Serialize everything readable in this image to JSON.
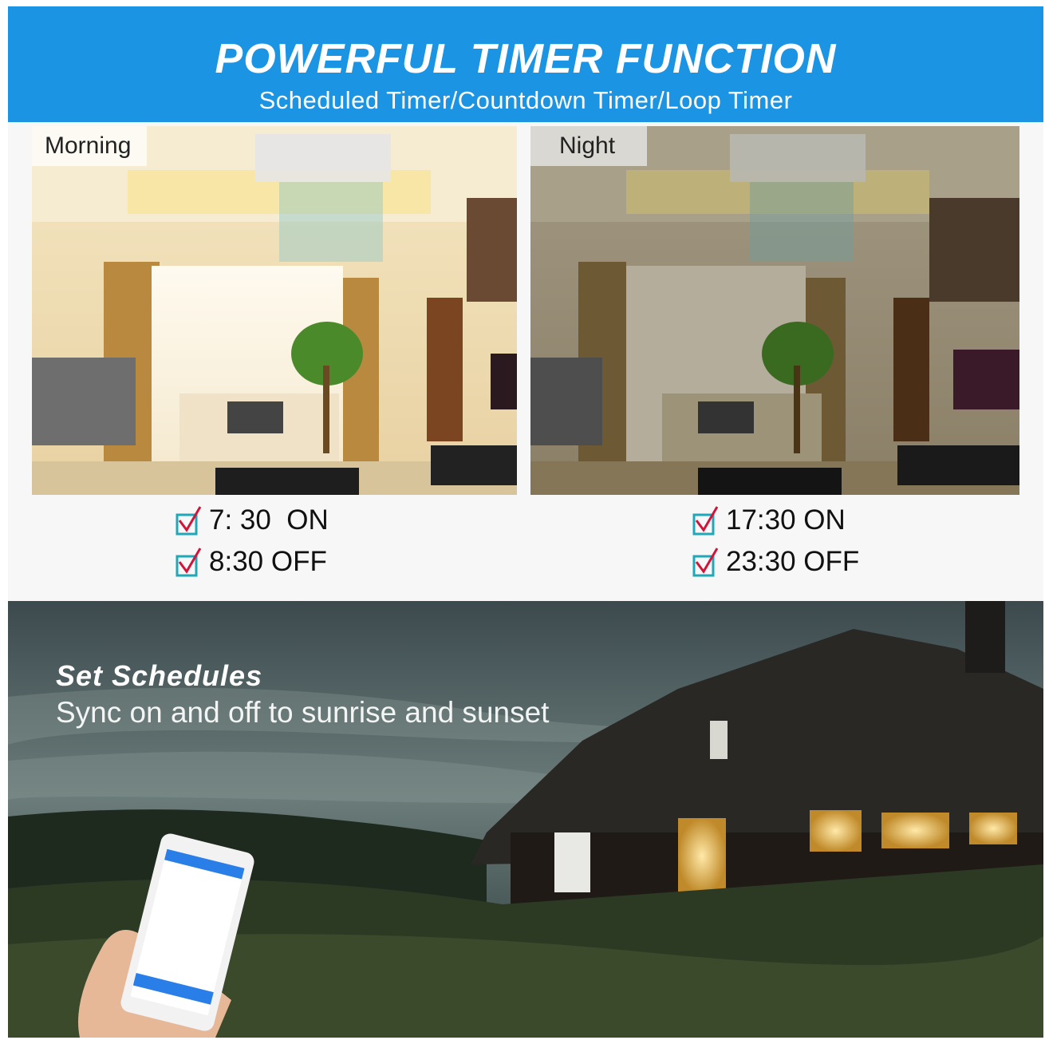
{
  "banner": {
    "title": "POWERFUL TIMER FUNCTION",
    "subtitle": "Scheduled Timer/Countdown Timer/Loop Timer"
  },
  "morning": {
    "label": "Morning",
    "on_text": "7: 30  ON",
    "off_text": "8:30 OFF"
  },
  "night": {
    "label": "Night",
    "on_text": "17:30 ON",
    "off_text": "23:30 OFF"
  },
  "scene": {
    "title": "Set Schedules",
    "subtitle": "Sync on and off to sunrise and sunset"
  },
  "colors": {
    "banner": "#1a94e3",
    "check_box": "#1fa8b8",
    "check_tick": "#d2143a"
  }
}
